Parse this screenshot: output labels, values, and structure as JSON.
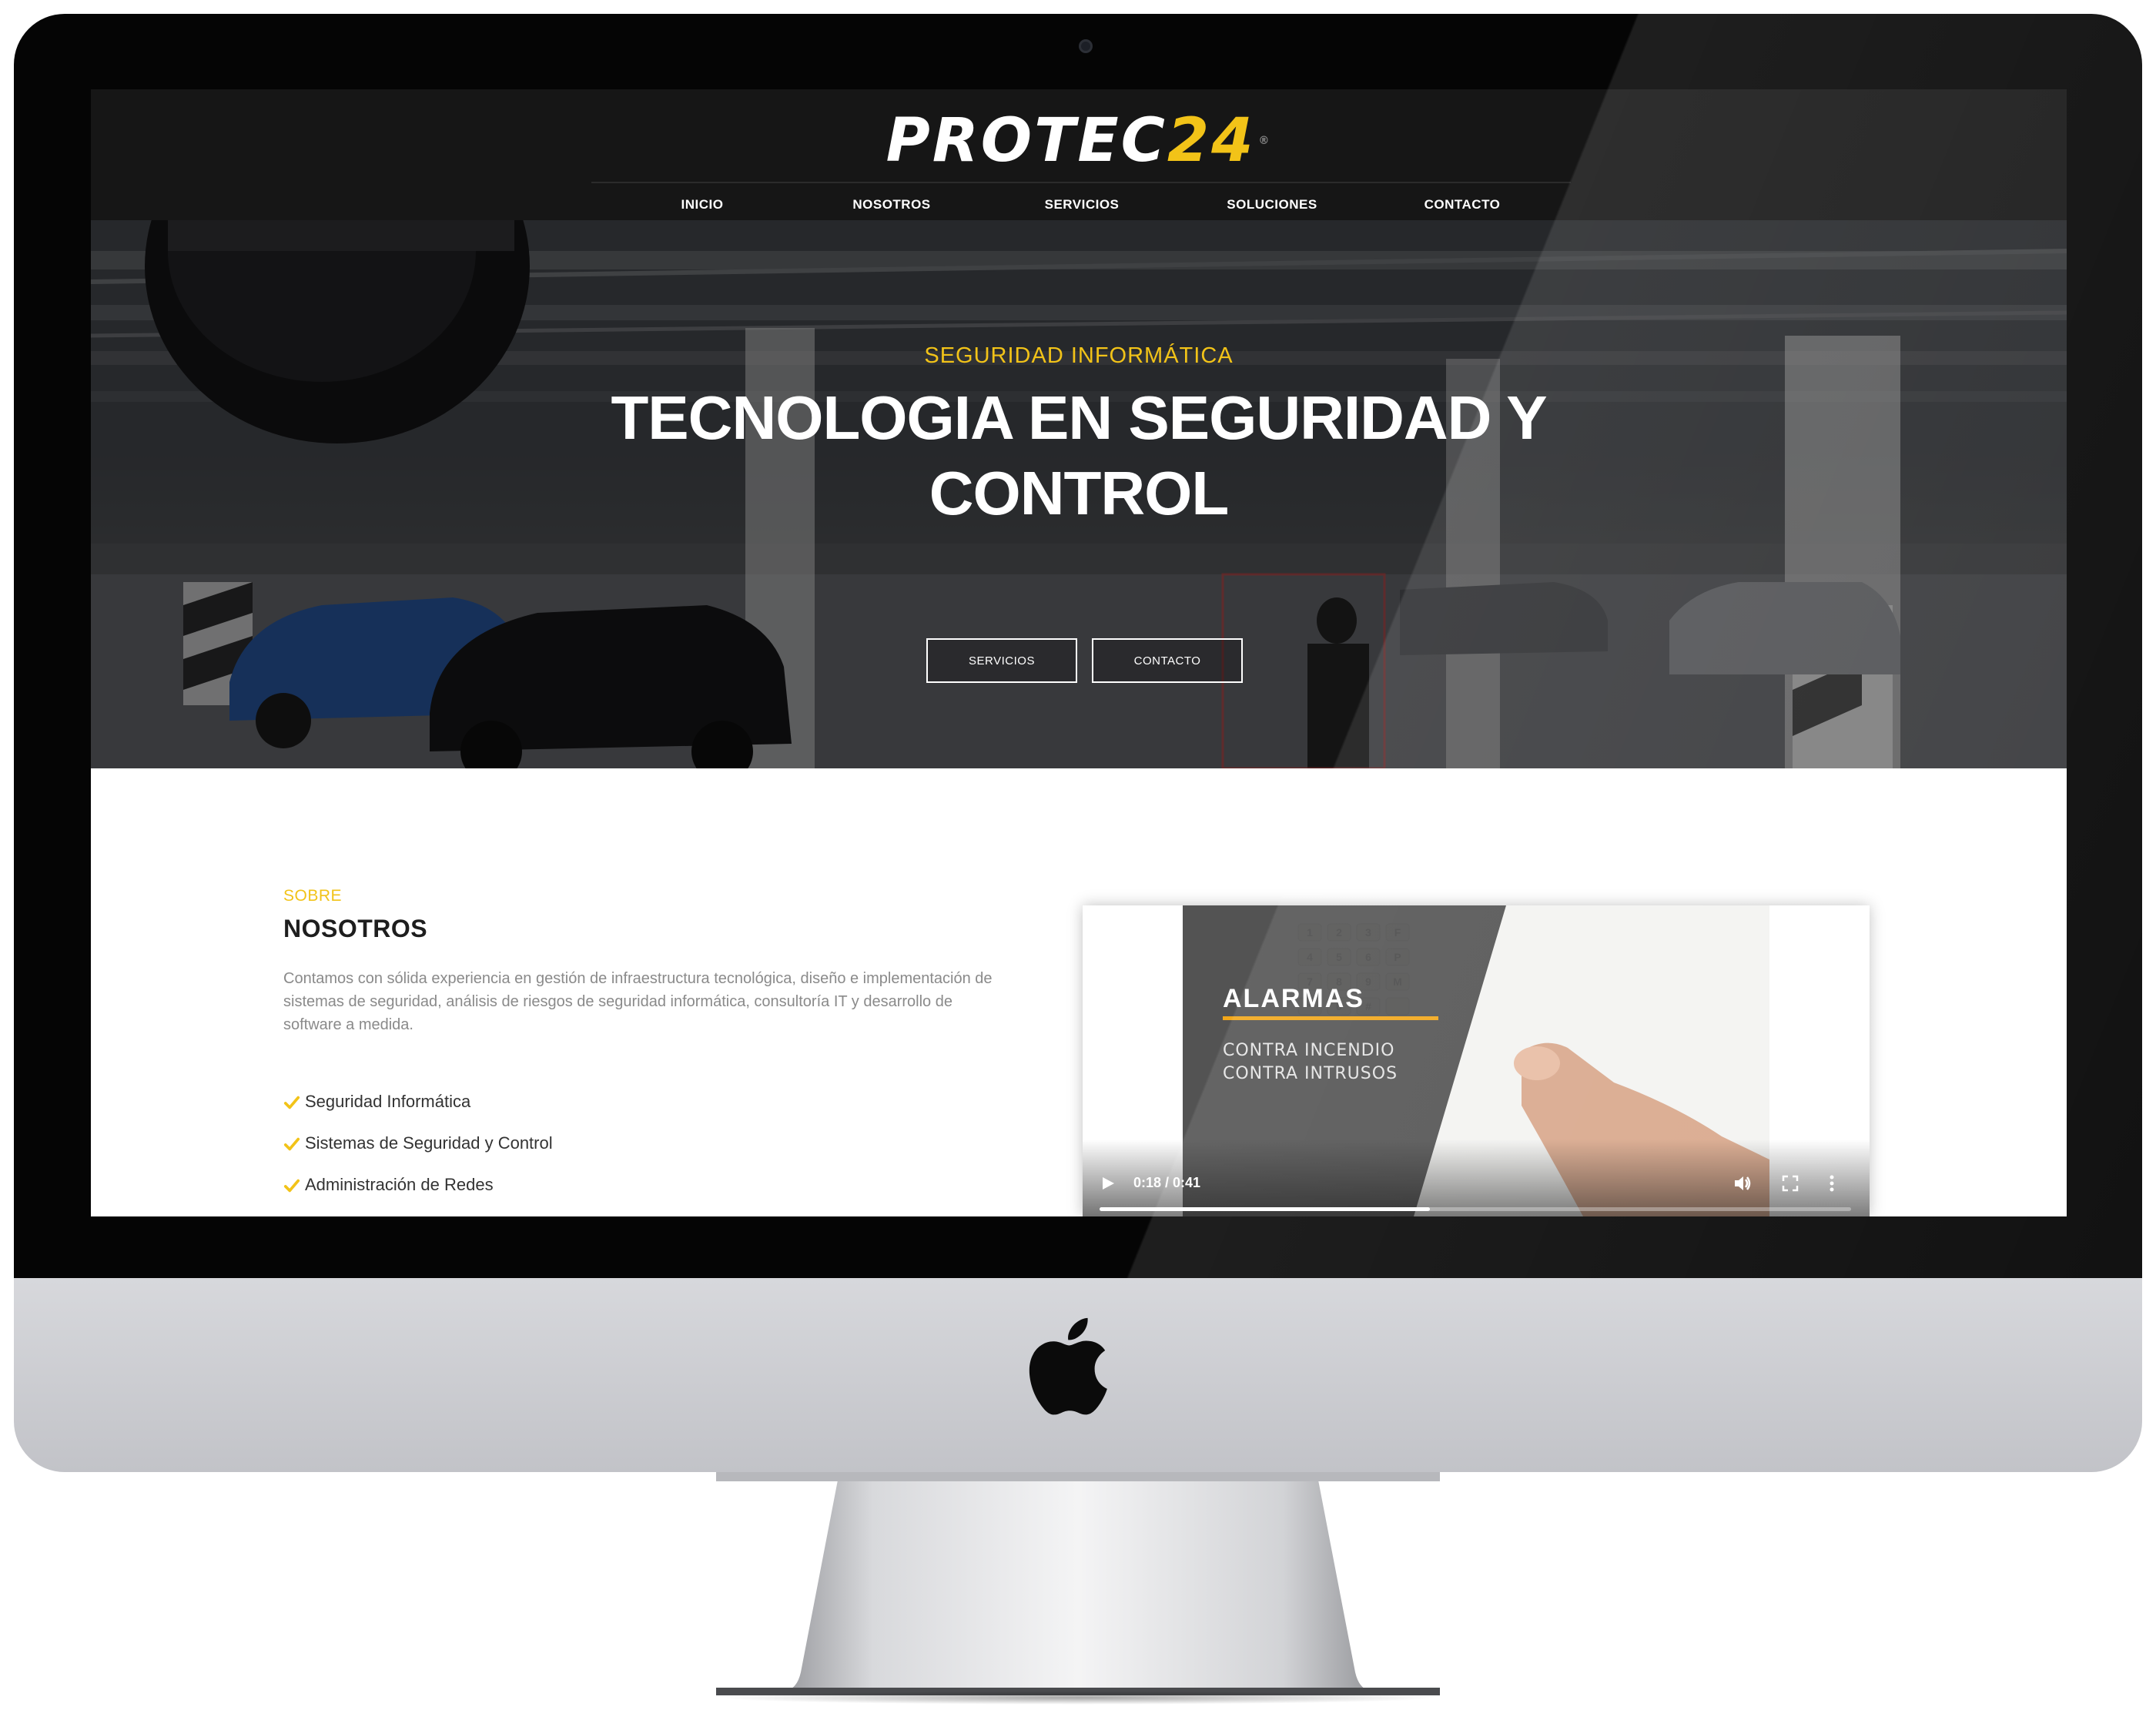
{
  "brand": {
    "logo_main": "PROTEC",
    "logo_num": "24",
    "logo_tm": "®",
    "accent_color": "#f2c318"
  },
  "nav": {
    "items": [
      {
        "label": "INICIO"
      },
      {
        "label": "NOSOTROS"
      },
      {
        "label": "SERVICIOS"
      },
      {
        "label": "SOLUCIONES"
      },
      {
        "label": "CONTACTO"
      }
    ]
  },
  "hero": {
    "kicker": "SEGURIDAD INFORMÁTICA",
    "title_line1": "TECNOLOGIA EN SEGURIDAD Y",
    "title_line2": "CONTROL",
    "buttons": [
      {
        "label": "SERVICIOS"
      },
      {
        "label": "CONTACTO"
      }
    ]
  },
  "about": {
    "kicker": "SOBRE",
    "title": "NOSOTROS",
    "text": "Contamos con sólida experiencia en gestión de infraestructura tecnológica, diseño e implementación de sistemas de seguridad, análisis de riesgos de seguridad informática, consultoría IT y desarrollo de software a medida.",
    "list": [
      {
        "label": "Seguridad Informática",
        "icon": "check-icon"
      },
      {
        "label": "Sistemas de Seguridad y Control",
        "icon": "check-icon"
      },
      {
        "label": "Administración de Redes",
        "icon": "check-icon"
      }
    ]
  },
  "video": {
    "heading": "ALARMAS",
    "sub1": "CONTRA INCENDIO",
    "sub2": "CONTRA INTRUSOS",
    "time": "0:18 / 0:41",
    "progress": 0.44,
    "keypad": [
      "1",
      "2",
      "3",
      "F",
      "4",
      "5",
      "6",
      "P",
      "7",
      "8",
      "9",
      "M",
      "*",
      "0",
      "#",
      ""
    ],
    "controls": [
      "play-icon",
      "volume-icon",
      "fullscreen-icon",
      "more-options-icon"
    ]
  }
}
